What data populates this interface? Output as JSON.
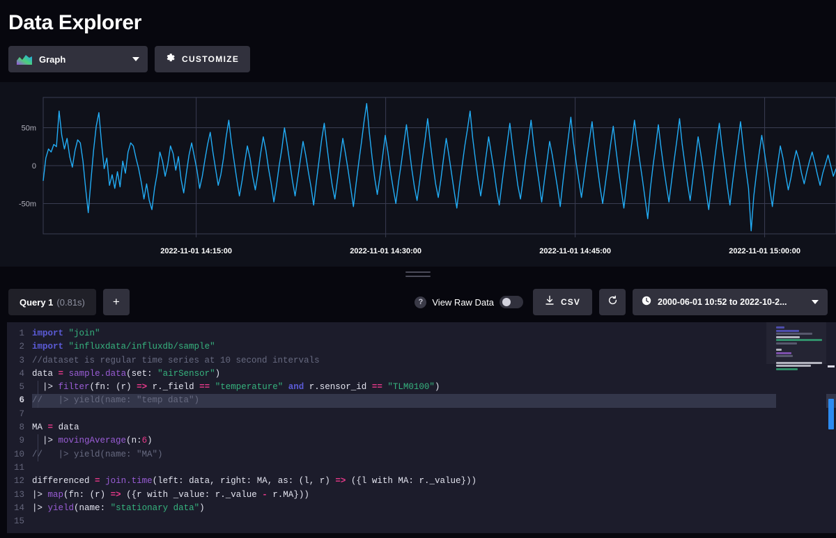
{
  "header": {
    "title": "Data Explorer"
  },
  "toolbar": {
    "viz_type_label": "Graph",
    "viz_icon": "area-chart-icon",
    "customize_label": "CUSTOMIZE",
    "customize_icon": "gear-icon",
    "dropdown_icon": "chevron-down-icon"
  },
  "query_bar": {
    "tab_name": "Query 1",
    "tab_duration": "(0.81s)",
    "add_label": "+",
    "raw_data_label": "View Raw Data",
    "raw_data_help": "?",
    "raw_data_on": false,
    "csv_label": "CSV",
    "csv_icon": "download-icon",
    "refresh_icon": "refresh-icon",
    "timerange_label": "2000-06-01 10:52 to 2022-10-2...",
    "timerange_icon": "clock-icon",
    "timerange_caret": "chevron-down-icon"
  },
  "editor": {
    "active_line": 6,
    "line_numbers": [
      "1",
      "2",
      "3",
      "4",
      "5",
      "6",
      "7",
      "8",
      "9",
      "10",
      "11",
      "12",
      "13",
      "14",
      "15"
    ],
    "lines": [
      "import \"join\"",
      "import \"influxdata/influxdb/sample\"",
      "//dataset is regular time series at 10 second intervals",
      "data = sample.data(set: \"airSensor\")",
      "  |> filter(fn: (r) => r._field == \"temperature\" and r.sensor_id == \"TLM0100\")",
      "//   |> yield(name: \"temp data\")",
      "",
      "MA = data",
      "  |> movingAverage(n:6)",
      "//   |> yield(name: \"MA\")",
      "",
      "differenced = join.time(left: data, right: MA, as: (l, r) => ({l with MA: r._value}))",
      "|> map(fn: (r) => ({r with _value: r._value - r.MA}))",
      "|> yield(name: \"stationary data\")",
      ""
    ]
  },
  "chart_data": {
    "type": "line",
    "title": "",
    "xlabel": "",
    "ylabel": "",
    "series_name": "stationary data",
    "line_color": "#22adf6",
    "grid": true,
    "legend_position": "none",
    "ylim": [
      -0.09,
      0.09
    ],
    "ytick_labels": [
      "50m",
      "0",
      "-50m"
    ],
    "ytick_values": [
      0.05,
      0,
      -0.05
    ],
    "xtick_labels": [
      "2022-11-01 14:15:00",
      "2022-11-01 14:30:00",
      "2022-11-01 14:45:00",
      "2022-11-01 15:00:00"
    ],
    "xtick_positions": [
      0.193,
      0.432,
      0.671,
      0.91
    ],
    "x_start": "2022-11-01 14:11:00",
    "x_end": "2022-11-01 15:04:00",
    "values": [
      -0.02,
      0.01,
      0.022,
      0.018,
      0.028,
      0.025,
      0.072,
      0.04,
      0.022,
      0.036,
      0.012,
      -0.002,
      0.02,
      0.034,
      0.03,
      0.006,
      -0.03,
      -0.062,
      -0.02,
      0.02,
      0.052,
      0.07,
      0.03,
      -0.004,
      0.01,
      -0.026,
      -0.012,
      -0.03,
      -0.008,
      -0.028,
      0.006,
      -0.01,
      0.018,
      0.03,
      0.026,
      0.01,
      -0.004,
      -0.022,
      -0.044,
      -0.024,
      -0.046,
      -0.058,
      -0.03,
      -0.01,
      0.018,
      0.006,
      -0.014,
      0.002,
      0.026,
      0.016,
      -0.006,
      0.012,
      -0.018,
      -0.036,
      -0.01,
      0.014,
      0.03,
      0.012,
      -0.006,
      -0.03,
      -0.014,
      0.008,
      0.028,
      0.044,
      0.018,
      -0.004,
      -0.026,
      -0.012,
      0.01,
      0.038,
      0.06,
      0.03,
      0.006,
      -0.018,
      -0.04,
      -0.02,
      0.004,
      0.026,
      0.01,
      -0.014,
      -0.032,
      -0.01,
      0.016,
      0.038,
      0.02,
      -0.004,
      -0.024,
      -0.048,
      -0.026,
      0.0,
      0.022,
      0.05,
      0.028,
      0.004,
      -0.02,
      -0.04,
      -0.016,
      0.008,
      0.032,
      0.014,
      -0.008,
      -0.028,
      -0.052,
      -0.022,
      0.006,
      0.034,
      0.056,
      0.026,
      -0.002,
      -0.026,
      -0.044,
      -0.018,
      0.01,
      0.036,
      0.016,
      -0.006,
      -0.03,
      -0.054,
      -0.024,
      0.004,
      0.03,
      0.058,
      0.082,
      0.044,
      0.012,
      -0.016,
      -0.038,
      -0.014,
      0.012,
      0.04,
      0.018,
      -0.008,
      -0.03,
      -0.05,
      -0.022,
      0.002,
      0.028,
      0.054,
      0.024,
      -0.004,
      -0.028,
      -0.046,
      -0.02,
      0.008,
      0.034,
      0.062,
      0.03,
      0.002,
      -0.024,
      -0.042,
      -0.018,
      0.01,
      0.036,
      0.014,
      -0.01,
      -0.034,
      -0.056,
      -0.026,
      0.0,
      0.026,
      0.048,
      0.072,
      0.036,
      0.008,
      -0.018,
      -0.04,
      -0.016,
      0.012,
      0.038,
      0.016,
      -0.006,
      -0.032,
      -0.052,
      -0.024,
      0.004,
      0.03,
      0.056,
      0.026,
      0.0,
      -0.026,
      -0.044,
      -0.018,
      0.01,
      0.034,
      0.06,
      0.028,
      0.002,
      -0.022,
      -0.048,
      -0.02,
      0.006,
      0.032,
      0.014,
      -0.008,
      -0.03,
      -0.054,
      -0.022,
      0.008,
      0.036,
      0.064,
      0.03,
      0.004,
      -0.02,
      -0.042,
      -0.016,
      0.01,
      0.034,
      0.058,
      0.026,
      -0.002,
      -0.028,
      -0.05,
      -0.024,
      0.002,
      0.028,
      0.052,
      0.022,
      -0.006,
      -0.032,
      -0.056,
      -0.026,
      0.004,
      0.03,
      0.06,
      0.032,
      0.006,
      -0.018,
      -0.044,
      -0.07,
      -0.03,
      0.0,
      0.026,
      0.054,
      0.024,
      -0.002,
      -0.026,
      -0.048,
      -0.02,
      0.008,
      0.034,
      0.062,
      0.028,
      0.002,
      -0.024,
      -0.046,
      -0.018,
      0.01,
      0.038,
      0.016,
      -0.008,
      -0.034,
      -0.058,
      -0.028,
      0.002,
      0.03,
      0.056,
      0.026,
      0.0,
      -0.028,
      -0.052,
      -0.022,
      0.006,
      0.032,
      0.058,
      0.026,
      -0.004,
      -0.03,
      -0.086,
      -0.04,
      -0.01,
      0.016,
      0.04,
      0.018,
      -0.006,
      -0.03,
      -0.054,
      -0.024,
      0.002,
      0.026,
      0.01,
      -0.012,
      -0.032,
      -0.016,
      0.004,
      0.02,
      0.008,
      -0.01,
      -0.024,
      -0.008,
      0.006,
      0.018,
      0.004,
      -0.012,
      -0.026,
      -0.01,
      0.002,
      0.014,
      0.0,
      -0.014,
      -0.004
    ]
  }
}
